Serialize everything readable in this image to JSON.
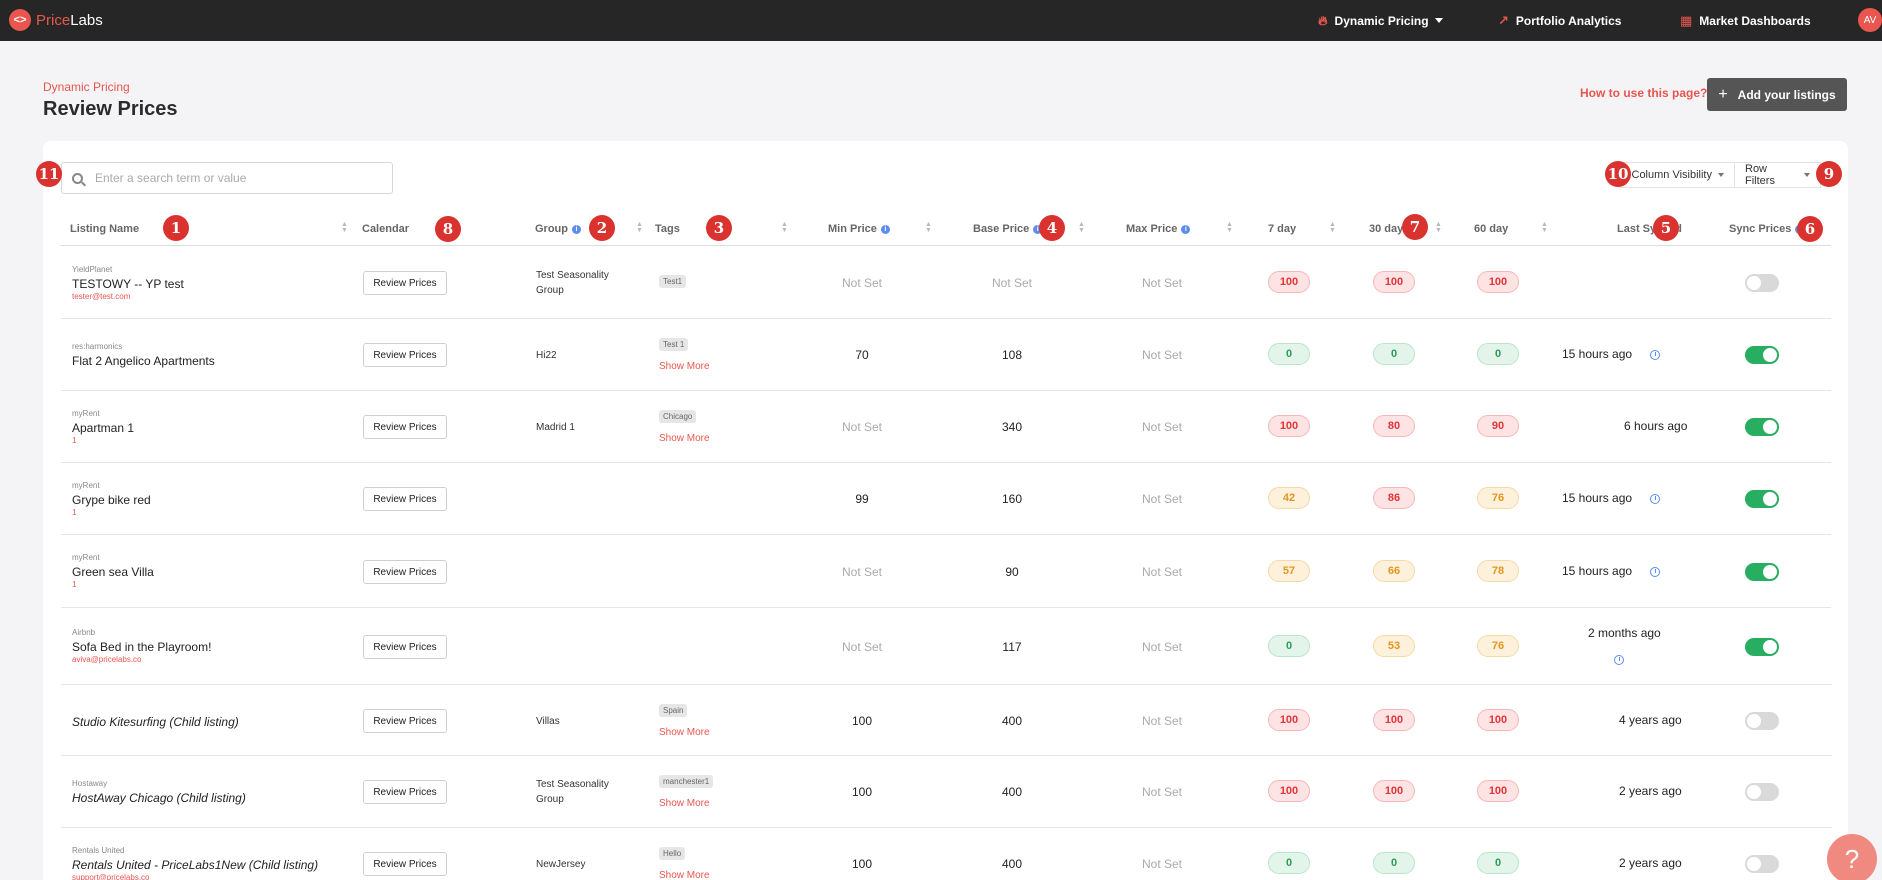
{
  "nav": {
    "logo_mark": "<>",
    "logo_a": "Price",
    "logo_b": "Labs",
    "dynamic_pricing": "Dynamic Pricing",
    "portfolio_analytics": "Portfolio Analytics",
    "market_dashboards": "Market Dashboards",
    "avatar": "AV"
  },
  "header": {
    "breadcrumb": "Dynamic Pricing",
    "title": "Review Prices",
    "how_to": "How to use this page?",
    "add_listings": "Add your listings"
  },
  "toolbar": {
    "search_placeholder": "Enter a search term or value",
    "column_visibility": "Column Visibility",
    "row_filters": "Row Filters"
  },
  "columns": {
    "listing_name": "Listing Name",
    "calendar": "Calendar",
    "group": "Group",
    "tags": "Tags",
    "min_price": "Min Price",
    "base_price": "Base Price",
    "max_price": "Max Price",
    "d7": "7 day",
    "d30": "30 day",
    "d60": "60 day",
    "last_synced": "Last Synced",
    "sync_prices": "Sync Prices"
  },
  "review_label": "Review Prices",
  "show_more": "Show More",
  "markers": [
    "1",
    "2",
    "3",
    "4",
    "5",
    "6",
    "7",
    "8",
    "9",
    "10",
    "11"
  ],
  "rows": [
    {
      "pms": "YieldPlanet",
      "name": "TESTOWY -- YP test",
      "sub": "tester@test.com",
      "group": "Test Seasonality Group",
      "tag": "Test1",
      "min": "Not Set",
      "base": "Not Set",
      "max": "Not Set",
      "d7": "100",
      "d30": "100",
      "d60": "100",
      "synced": "",
      "sync_on": false
    },
    {
      "pms": "res:harmonics",
      "name": "Flat 2 Angelico Apartments",
      "sub": "",
      "group": "Hi22",
      "tag": "Test 1",
      "min": "70",
      "base": "108",
      "max": "Not Set",
      "d7": "0",
      "d30": "0",
      "d60": "0",
      "synced": "15 hours ago",
      "sync_on": true
    },
    {
      "pms": "myRent",
      "name": "Apartman 1",
      "sub": "1",
      "group": "Madrid 1",
      "tag": "Chicago",
      "min": "Not Set",
      "base": "340",
      "max": "Not Set",
      "d7": "100",
      "d30": "80",
      "d60": "90",
      "synced": "6 hours ago",
      "sync_on": true
    },
    {
      "pms": "myRent",
      "name": "Grype bike red",
      "sub": "1",
      "group": "",
      "tag": "",
      "min": "99",
      "base": "160",
      "max": "Not Set",
      "d7": "42",
      "d30": "86",
      "d60": "76",
      "synced": "15 hours ago",
      "sync_on": true
    },
    {
      "pms": "myRent",
      "name": "Green sea Villa",
      "sub": "1",
      "group": "",
      "tag": "",
      "min": "Not Set",
      "base": "90",
      "max": "Not Set",
      "d7": "57",
      "d30": "66",
      "d60": "78",
      "synced": "15 hours ago",
      "sync_on": true
    },
    {
      "pms": "Airbnb",
      "name": "Sofa Bed in the Playroom!",
      "sub": "aviva@pricelabs.co",
      "group": "",
      "tag": "",
      "min": "Not Set",
      "base": "117",
      "max": "Not Set",
      "d7": "0",
      "d30": "53",
      "d60": "76",
      "synced": "2 months ago",
      "sync_on": true
    },
    {
      "pms": "",
      "name": "Studio Kitesurfing (Child listing)",
      "sub": "",
      "group": "Villas",
      "tag": "Spain",
      "min": "100",
      "base": "400",
      "max": "Not Set",
      "d7": "100",
      "d30": "100",
      "d60": "100",
      "synced": "4 years ago",
      "sync_on": false
    },
    {
      "pms": "Hostaway",
      "name": "HostAway Chicago (Child listing)",
      "sub": "",
      "group": "Test Seasonality Group",
      "tag": "manchester1",
      "min": "100",
      "base": "400",
      "max": "Not Set",
      "d7": "100",
      "d30": "100",
      "d60": "100",
      "synced": "2 years ago",
      "sync_on": false
    },
    {
      "pms": "Rentals United",
      "name": "Rentals United - PriceLabs1New (Child listing)",
      "sub": "support@pricelabs.co",
      "group": "NewJersey",
      "tag": "Hello",
      "min": "100",
      "base": "400",
      "max": "Not Set",
      "d7": "0",
      "d30": "0",
      "d60": "0",
      "synced": "2 years ago",
      "sync_on": false
    }
  ],
  "colors": {
    "accent": "#e8564f",
    "toggle_on": "#27ae60",
    "nav_bg": "#262626"
  },
  "help_label": "?"
}
